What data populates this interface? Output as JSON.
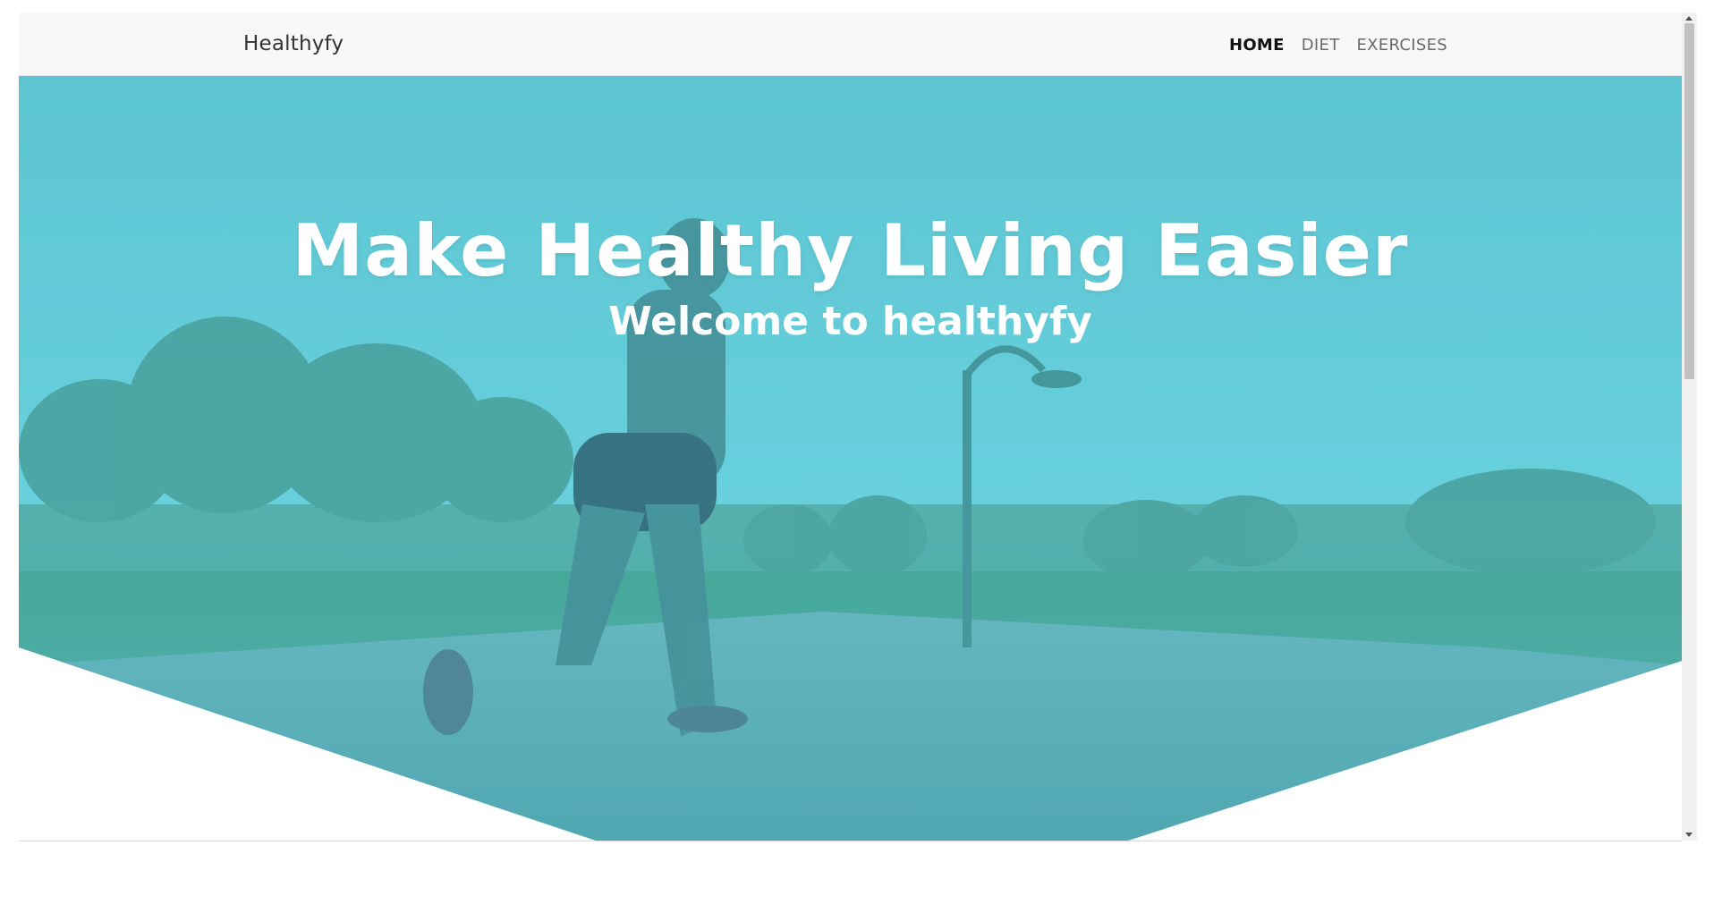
{
  "navbar": {
    "brand": "Healthyfy",
    "links": [
      {
        "label": "HOME",
        "active": true
      },
      {
        "label": "DIET",
        "active": false
      },
      {
        "label": "EXERCISES",
        "active": false
      }
    ]
  },
  "hero": {
    "headline": "Make Healthy Living Easier",
    "subheadline": "Welcome to healthyfy",
    "overlay_color": "#5fcfdc"
  }
}
